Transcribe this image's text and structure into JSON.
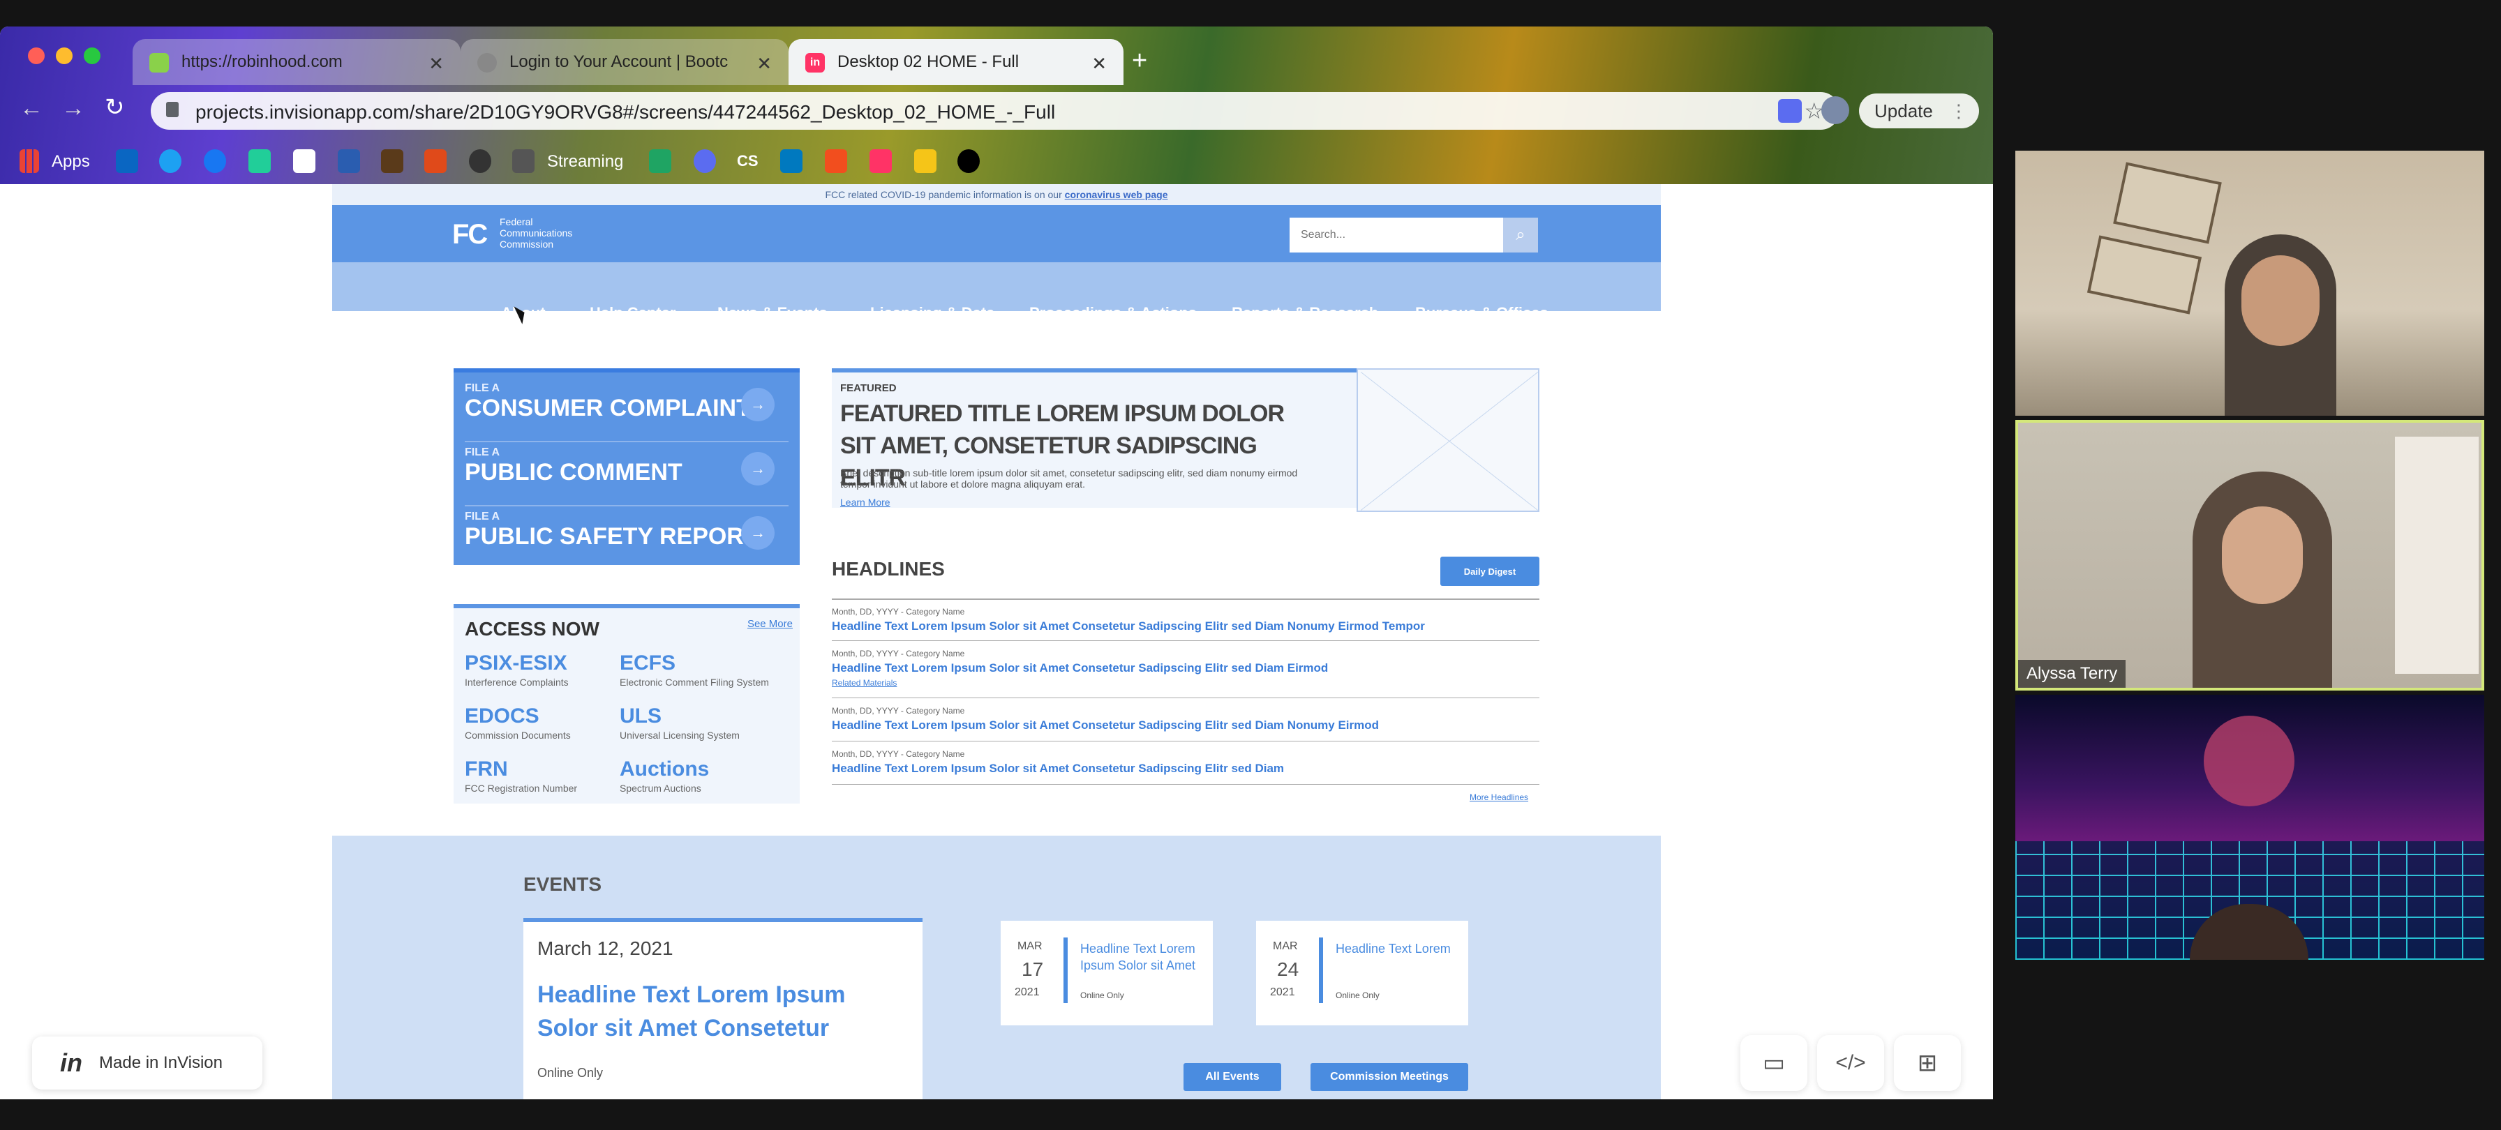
{
  "browser": {
    "tabs": [
      {
        "title": "https://robinhood.com",
        "active": false
      },
      {
        "title": "Login to Your Account | Bootc",
        "active": false
      },
      {
        "title": "Desktop 02 HOME - Full",
        "active": true
      }
    ],
    "url": "projects.invisionapp.com/share/2D10GY9ORVG8#/screens/447244562_Desktop_02_HOME_-_Full",
    "update_label": "Update",
    "bookmarks": {
      "apps": "Apps",
      "streaming": "Streaming",
      "cs": "CS"
    }
  },
  "site": {
    "covid_banner": "FCC related COVID-19 pandemic information is on our",
    "covid_link": "coronavirus web page",
    "logo_lines": [
      "Federal",
      "Communications",
      "Commission"
    ],
    "logo_mark": "FC",
    "search_placeholder": "Search...",
    "nav": [
      "About",
      "Help Center",
      "News & Events",
      "Licensing & Data",
      "Proceedings & Actions",
      "Reports & Research",
      "Bureaus & Offices"
    ],
    "file_items": [
      {
        "pre": "FILE A",
        "label": "CONSUMER COMPLAINT"
      },
      {
        "pre": "FILE A",
        "label": "PUBLIC COMMENT"
      },
      {
        "pre": "FILE A",
        "label": "PUBLIC SAFETY REPORT"
      }
    ],
    "featured": {
      "kicker": "FEATURED",
      "title": "FEATURED TITLE LOREM IPSUM DOLOR SIT AMET, CONSETETUR SADIPSCING ELITR",
      "desc": "Brief description sub-title lorem ipsum dolor sit amet, consetetur sadipscing elitr, sed diam nonumy eirmod tempor invidunt ut labore et dolore magna aliquyam erat.",
      "link": "Learn More"
    },
    "headlines": {
      "heading": "HEADLINES",
      "button": "Daily Digest",
      "items": [
        {
          "meta": "Month, DD, YYYY - Category Name",
          "title": "Headline Text Lorem Ipsum Solor sit Amet Consetetur Sadipscing Elitr sed Diam Nonumy Eirmod Tempor",
          "extra": ""
        },
        {
          "meta": "Month, DD, YYYY - Category Name",
          "title": "Headline Text Lorem Ipsum Solor sit Amet Consetetur Sadipscing Elitr sed Diam Eirmod",
          "extra": "Related Materials"
        },
        {
          "meta": "Month, DD, YYYY - Category Name",
          "title": "Headline Text Lorem Ipsum Solor sit Amet Consetetur Sadipscing Elitr sed Diam Nonumy Eirmod",
          "extra": ""
        },
        {
          "meta": "Month, DD, YYYY - Category Name",
          "title": "Headline Text Lorem Ipsum Solor sit Amet Consetetur Sadipscing Elitr sed Diam",
          "extra": ""
        }
      ],
      "more": "More Headlines"
    },
    "access": {
      "heading": "ACCESS NOW",
      "see_more": "See More",
      "items": [
        {
          "title": "PSIX-ESIX",
          "sub": "Interference Complaints"
        },
        {
          "title": "ECFS",
          "sub": "Electronic Comment Filing System"
        },
        {
          "title": "EDOCS",
          "sub": "Commission Documents"
        },
        {
          "title": "ULS",
          "sub": "Universal Licensing System"
        },
        {
          "title": "FRN",
          "sub": "FCC Registration Number"
        },
        {
          "title": "Auctions",
          "sub": "Spectrum Auctions"
        }
      ]
    },
    "events": {
      "heading": "EVENTS",
      "main": {
        "date": "March 12, 2021",
        "title": "Headline Text Lorem Ipsum Solor sit Amet Consetetur",
        "mode": "Online Only"
      },
      "small": [
        {
          "month": "MAR",
          "day": "17",
          "year": "2021",
          "title": "Headline Text Lorem Ipsum Solor sit Amet",
          "mode": "Online Only"
        },
        {
          "month": "MAR",
          "day": "24",
          "year": "2021",
          "title": "Headline Text Lorem",
          "mode": "Online Only"
        }
      ],
      "buttons": [
        "All Events",
        "Commission Meetings"
      ]
    }
  },
  "invision": {
    "badge": "Made in InVision"
  },
  "video": {
    "participant_name": "Alyssa Terry"
  }
}
